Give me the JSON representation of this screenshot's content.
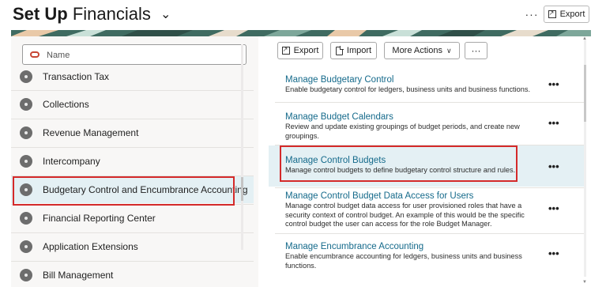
{
  "header": {
    "title_bold": "Set Up",
    "title_light": "Financials",
    "more_label": "···",
    "export_label": "Export"
  },
  "search": {
    "placeholder": "Name",
    "value": ""
  },
  "functional_areas": [
    {
      "label": "Transaction Tax",
      "selected": false
    },
    {
      "label": "Collections",
      "selected": false
    },
    {
      "label": "Revenue Management",
      "selected": false
    },
    {
      "label": "Intercompany",
      "selected": false
    },
    {
      "label": "Budgetary Control and Encumbrance Accounting",
      "selected": true
    },
    {
      "label": "Financial Reporting Center",
      "selected": false
    },
    {
      "label": "Application Extensions",
      "selected": false
    },
    {
      "label": "Bill Management",
      "selected": false
    }
  ],
  "toolbar": {
    "export_label": "Export",
    "import_label": "Import",
    "more_actions_label": "More Actions",
    "overflow_label": "···"
  },
  "tasks": [
    {
      "title": "Manage Budgetary Control",
      "description": "Enable budgetary control for ledgers, business units and business functions.",
      "highlighted": false
    },
    {
      "title": "Manage Budget Calendars",
      "description": "Review and update existing groupings of budget periods, and create new groupings.",
      "highlighted": false
    },
    {
      "title": "Manage Control Budgets",
      "description": "Manage control budgets to define budgetary control structure and rules.",
      "highlighted": true
    },
    {
      "title": "Manage Control Budget Data Access for Users",
      "description": "Manage control budget data access for user provisioned roles that have a security context of control budget. An example of this would be the specific control budget the user can access for the role Budget Manager.",
      "highlighted": false
    },
    {
      "title": "Manage Encumbrance Accounting",
      "description": "Enable encumbrance accounting for ledgers, business units and business functions.",
      "highlighted": false
    }
  ],
  "task_more_label": "•••",
  "colors": {
    "accent_link": "#156a8b",
    "selected_bg": "#e4f0f4",
    "annotation_red": "#d42a2a",
    "search_icon": "#c74634"
  }
}
